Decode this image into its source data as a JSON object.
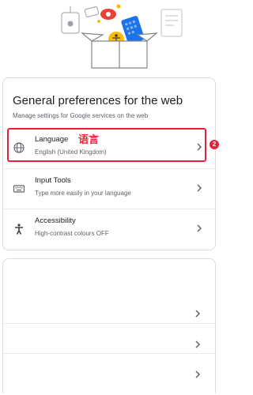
{
  "card": {
    "title": "General preferences for the web",
    "subtitle": "Manage settings for Google services on the web"
  },
  "rows": [
    {
      "label": "Language",
      "sub": "English (United Kingdom)",
      "icon": "globe-icon",
      "annotation": "语言"
    },
    {
      "label": "Input Tools",
      "sub": "Type more easily in your language",
      "icon": "keyboard-icon"
    },
    {
      "label": "Accessibility",
      "sub": "High-contrast colours OFF",
      "icon": "accessibility-icon"
    }
  ],
  "step_badge": "2",
  "colors": {
    "highlight": "#e8213a",
    "accent_blue": "#1a73e8",
    "yellow": "#fbbc04"
  }
}
